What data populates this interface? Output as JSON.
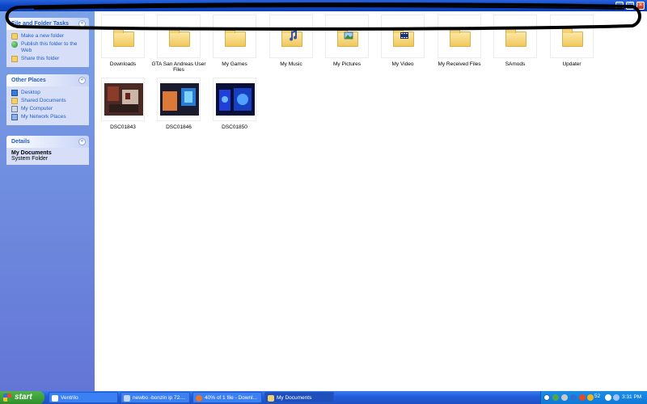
{
  "window": {
    "title": "",
    "buttons": [
      "minimize-button",
      "maximize-button",
      "close-button"
    ]
  },
  "taskpane": {
    "file_folder_tasks": {
      "title": "File and Folder Tasks",
      "items": [
        {
          "label": "Make a new folder",
          "icon": "new-folder-icon"
        },
        {
          "label": "Publish this folder to the Web",
          "icon": "globe-icon"
        },
        {
          "label": "Share this folder",
          "icon": "share-icon"
        }
      ]
    },
    "other_places": {
      "title": "Other Places",
      "items": [
        {
          "label": "Desktop",
          "icon": "desktop-icon"
        },
        {
          "label": "Shared Documents",
          "icon": "folder-icon"
        },
        {
          "label": "My Computer",
          "icon": "computer-icon"
        },
        {
          "label": "My Network Places",
          "icon": "network-icon"
        }
      ]
    },
    "details": {
      "title": "Details",
      "name": "My Documents",
      "type": "System Folder"
    }
  },
  "files": {
    "folders": [
      {
        "label": "Downloads",
        "badge": ""
      },
      {
        "label": "GTA San Andreas User Files",
        "badge": ""
      },
      {
        "label": "My Games",
        "badge": ""
      },
      {
        "label": "My Music",
        "badge": "music"
      },
      {
        "label": "My Pictures",
        "badge": "pictures"
      },
      {
        "label": "My Video",
        "badge": "video"
      },
      {
        "label": "My Received Files",
        "badge": ""
      },
      {
        "label": "SAmods",
        "badge": ""
      },
      {
        "label": "Updater",
        "badge": ""
      }
    ],
    "photos": [
      {
        "label": "DSC01843"
      },
      {
        "label": "DSC01846"
      },
      {
        "label": "DSC01850"
      }
    ]
  },
  "taskbar": {
    "start_label": "start",
    "tasks": [
      {
        "label": "Ventrilo"
      },
      {
        "label": "newbo -bonzin ip 72...."
      },
      {
        "label": "40% of 1 file - Downl..."
      },
      {
        "label": "My Documents"
      }
    ],
    "tray_number": "52",
    "clock": "3:31 PM"
  }
}
